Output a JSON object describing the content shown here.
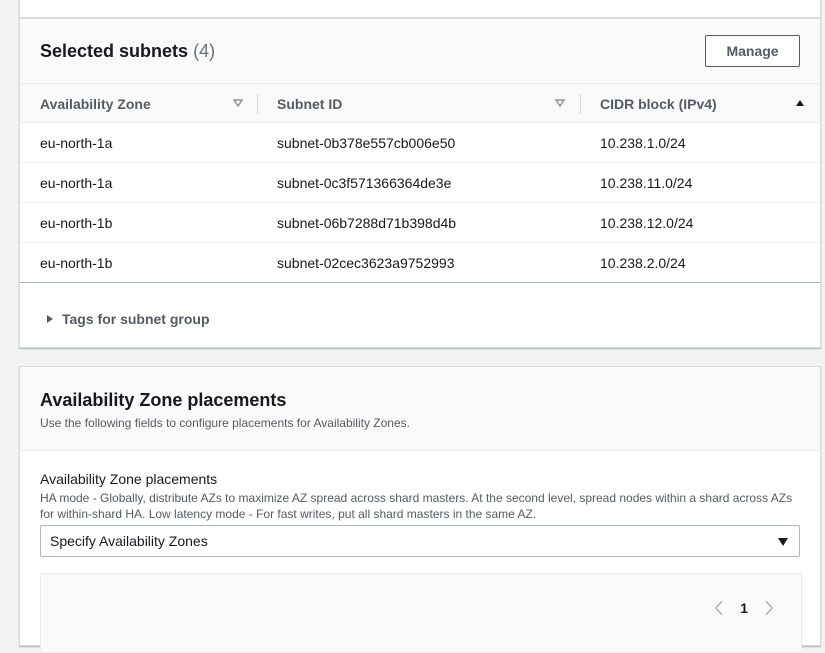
{
  "subnets": {
    "title": "Selected subnets",
    "count": "(4)",
    "manage_label": "Manage",
    "columns": [
      "Availability Zone",
      "Subnet ID",
      "CIDR block (IPv4)"
    ],
    "rows": [
      {
        "az": "eu-north-1a",
        "subnet_id": "subnet-0b378e557cb006e50",
        "cidr": "10.238.1.0/24"
      },
      {
        "az": "eu-north-1a",
        "subnet_id": "subnet-0c3f571366364de3e",
        "cidr": "10.238.11.0/24"
      },
      {
        "az": "eu-north-1b",
        "subnet_id": "subnet-06b7288d71b398d4b",
        "cidr": "10.238.12.0/24"
      },
      {
        "az": "eu-north-1b",
        "subnet_id": "subnet-02cec3623a9752993",
        "cidr": "10.238.2.0/24"
      }
    ],
    "tags_label": "Tags for subnet group"
  },
  "az_placements": {
    "title": "Availability Zone placements",
    "description": "Use the following fields to configure placements for Availability Zones.",
    "field_label": "Availability Zone placements",
    "field_description": "HA mode - Globally, distribute AZs to maximize AZ spread across shard masters. At the second level, spread nodes within a shard across AZs for within-shard HA. Low latency mode - For fast writes, put all shard masters in the same AZ.",
    "select_value": "Specify Availability Zones",
    "pagination": {
      "current_page": "1"
    }
  }
}
